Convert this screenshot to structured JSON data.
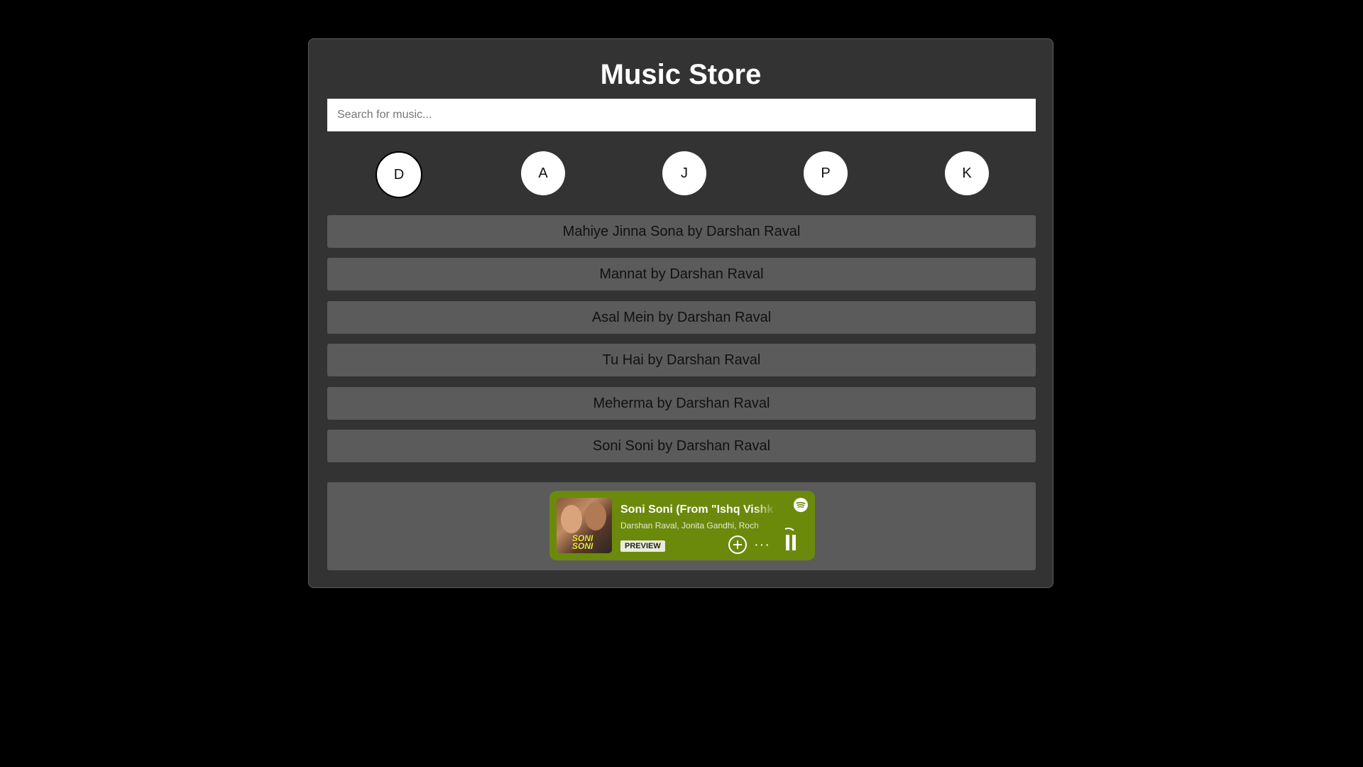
{
  "app": {
    "title": "Music Store"
  },
  "search": {
    "placeholder": "Search for music...",
    "value": ""
  },
  "letters": [
    {
      "label": "D",
      "active": true
    },
    {
      "label": "A",
      "active": false
    },
    {
      "label": "J",
      "active": false
    },
    {
      "label": "P",
      "active": false
    },
    {
      "label": "K",
      "active": false
    }
  ],
  "songs": [
    {
      "label": "Mahiye Jinna Sona by Darshan Raval"
    },
    {
      "label": "Mannat by Darshan Raval"
    },
    {
      "label": "Asal Mein by Darshan Raval"
    },
    {
      "label": "Tu Hai by Darshan Raval"
    },
    {
      "label": "Meherma by Darshan Raval"
    },
    {
      "label": "Soni Soni by Darshan Raval"
    }
  ],
  "player": {
    "track_title": "Soni Soni (From \"Ishq Vishk",
    "artists": "Darshan Raval, Jonita Gandhi, Roch",
    "badge": "PREVIEW",
    "cover_text_line1": "SONI",
    "cover_text_line2": "SONI",
    "more_label": "···",
    "embed_color": "#6b8a0c",
    "icons": [
      "spotify-icon",
      "add-icon",
      "more-icon",
      "pause-icon"
    ]
  }
}
